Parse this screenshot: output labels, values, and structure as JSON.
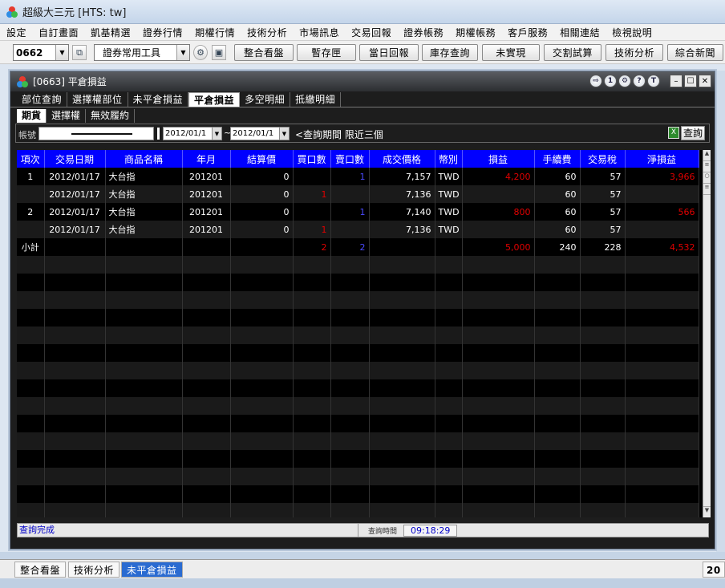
{
  "app": {
    "title": "超級大三元 [HTS: tw]"
  },
  "menu": [
    "設定",
    "自訂畫面",
    "凱基精選",
    "證券行情",
    "期權行情",
    "技術分析",
    "市場訊息",
    "交易回報",
    "證券帳務",
    "期權帳務",
    "客戶服務",
    "相關連結",
    "檢視說明"
  ],
  "toolbar": {
    "code_value": "0662",
    "tool_select": "證券常用工具",
    "buttons": [
      "整合看盤",
      "暫存匣",
      "當日回報",
      "庫存查詢",
      "未實現",
      "交割試算",
      "技術分析",
      "綜合新聞"
    ]
  },
  "window": {
    "title": "[0663] 平倉損益",
    "tabs": [
      "部位查詢",
      "選擇權部位",
      "未平倉損益",
      "平倉損益",
      "多空明細",
      "抵繳明細"
    ],
    "active_tab": "平倉損益",
    "subtabs": [
      "期貨",
      "選擇權",
      "無效履約"
    ],
    "active_subtab": "期貨",
    "filter": {
      "account_label": "帳號",
      "date_from": "2012/01/1",
      "tilde": "~",
      "date_to": "2012/01/1",
      "note": "<查詢期間 限近三個",
      "query_button": "查詢"
    },
    "table": {
      "columns": [
        "項次",
        "交易日期",
        "商品名稱",
        "年月",
        "結算價",
        "買口數",
        "賣口數",
        "成交價格",
        "幣別",
        "損益",
        "手續費",
        "交易稅",
        "淨損益"
      ],
      "rows": [
        {
          "idx": "1",
          "date": "2012/01/17",
          "product": "大台指",
          "ym": "201201",
          "settle": "0",
          "buy": "",
          "sell": "1",
          "price": "7,157",
          "currency": "TWD",
          "pnl": "4,200",
          "fee": "60",
          "tax": "57",
          "net": "3,966"
        },
        {
          "idx": "",
          "date": "2012/01/17",
          "product": "大台指",
          "ym": "201201",
          "settle": "0",
          "buy": "1",
          "sell": "",
          "price": "7,136",
          "currency": "TWD",
          "pnl": "",
          "fee": "60",
          "tax": "57",
          "net": ""
        },
        {
          "idx": "2",
          "date": "2012/01/17",
          "product": "大台指",
          "ym": "201201",
          "settle": "0",
          "buy": "",
          "sell": "1",
          "price": "7,140",
          "currency": "TWD",
          "pnl": "800",
          "fee": "60",
          "tax": "57",
          "net": "566"
        },
        {
          "idx": "",
          "date": "2012/01/17",
          "product": "大台指",
          "ym": "201201",
          "settle": "0",
          "buy": "1",
          "sell": "",
          "price": "7,136",
          "currency": "TWD",
          "pnl": "",
          "fee": "60",
          "tax": "57",
          "net": ""
        },
        {
          "idx": "小計",
          "date": "",
          "product": "",
          "ym": "",
          "settle": "",
          "buy": "2",
          "sell": "2",
          "price": "",
          "currency": "",
          "pnl": "5,000",
          "fee": "240",
          "tax": "228",
          "net": "4,532"
        }
      ]
    },
    "status": {
      "message": "查詢完成",
      "time_label": "查詢時間",
      "time": "09:18:29"
    }
  },
  "bottom_tabs": [
    "整合看盤",
    "技術分析",
    "未平倉損益"
  ],
  "bottom_active": "未平倉損益",
  "bottom_right_text": "20",
  "colors": {
    "header_blue": "#0000ff",
    "profit_red": "#e00000",
    "qty_blue": "#4a4aff"
  }
}
